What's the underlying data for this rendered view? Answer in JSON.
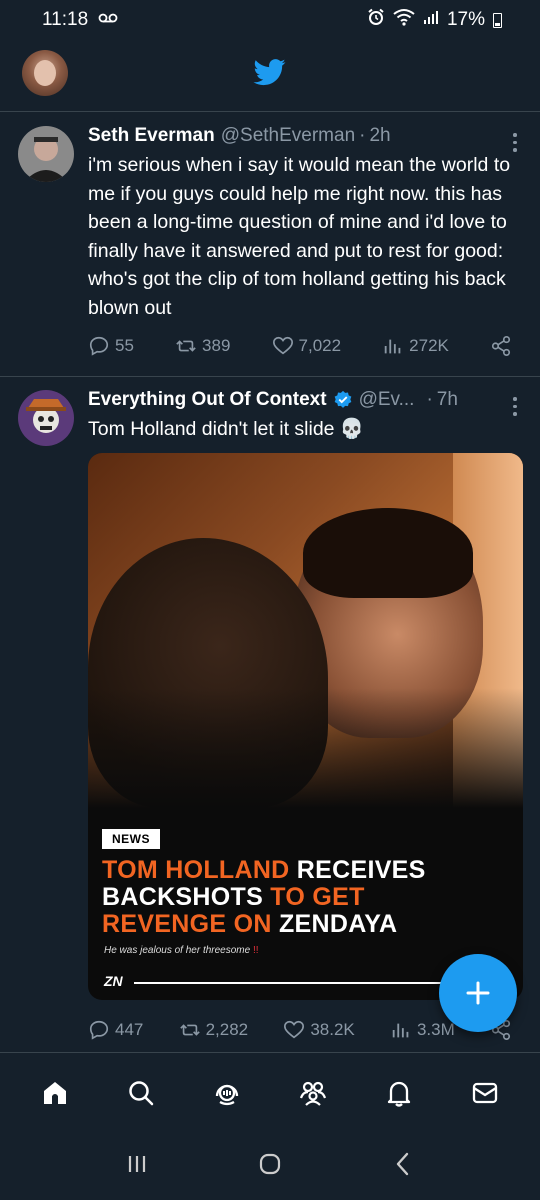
{
  "status_bar": {
    "time": "11:18",
    "battery": "17%"
  },
  "tweets": [
    {
      "display_name": "Seth Everman",
      "handle": "@SethEverman",
      "time": "2h",
      "text": "i'm serious when i say it would mean the world to me if you guys could help me right now. this has been a long-time question of mine and i'd love to finally have it answered and put to rest for good: who's got the clip of tom holland getting his back blown out",
      "replies": "55",
      "retweets": "389",
      "likes": "7,022",
      "views": "272K"
    },
    {
      "display_name": "Everything Out Of Context",
      "handle": "@Ev...",
      "time": "7h",
      "text": "Tom Holland didn't let it slide 💀",
      "replies": "447",
      "retweets": "2,282",
      "likes": "38.2K",
      "views": "3.3M",
      "media": {
        "badge": "NEWS",
        "headline_1": "TOM HOLLAND",
        "headline_2": " RECEIVES",
        "headline_3": "BACKSHOTS",
        "headline_4": " TO GET",
        "headline_5": "REVENGE ON",
        "headline_6": " ZENDAYA",
        "subline": "He was jealous of her threesome",
        "subline_bang": " !!",
        "brand": "ZN"
      }
    }
  ],
  "colors": {
    "background": "#15202b",
    "accent": "#1d9bf0",
    "secondary_text": "#8b98a5",
    "divider": "#38444d",
    "headline_orange": "#f26522"
  },
  "icons": {
    "header": "twitter-bird-icon",
    "fab": "plus-icon",
    "tabs": [
      "home-icon",
      "search-icon",
      "spaces-icon",
      "communities-icon",
      "notifications-icon",
      "messages-icon"
    ],
    "system_nav": [
      "recents-icon",
      "home-circle-icon",
      "back-icon"
    ]
  }
}
